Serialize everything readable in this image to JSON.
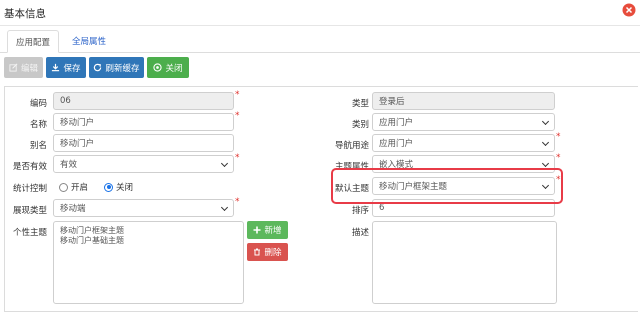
{
  "dialog": {
    "title": "基本信息"
  },
  "tabs": [
    {
      "label": "应用配置"
    },
    {
      "label": "全局属性"
    }
  ],
  "toolbar": {
    "edit_label": "编辑",
    "save_label": "保存",
    "refresh_label": "刷新缓存",
    "close_label": "关闭"
  },
  "form": {
    "code": {
      "label": "编码",
      "value": "06"
    },
    "name": {
      "label": "名称",
      "value": "移动门户"
    },
    "alias": {
      "label": "别名",
      "value": "移动门户"
    },
    "valid": {
      "label": "是否有效",
      "value": "有效"
    },
    "stats": {
      "label": "统计控制",
      "options": [
        "开启",
        "关闭"
      ],
      "selected": "关闭"
    },
    "display_type": {
      "label": "展现类型",
      "value": "移动端"
    },
    "personal_theme": {
      "label": "个性主题",
      "items": [
        "移动门户框架主题",
        "移动门户基础主题"
      ]
    },
    "type": {
      "label": "类型",
      "value": "登录后"
    },
    "category": {
      "label": "类别",
      "value": "应用门户"
    },
    "nav_use": {
      "label": "导航用途",
      "value": "应用门户"
    },
    "theme_attr": {
      "label": "主题属性",
      "value": "嵌入模式"
    },
    "default_theme": {
      "label": "默认主题",
      "value": "移动门户框架主题"
    },
    "order": {
      "label": "排序",
      "value": "6"
    },
    "description": {
      "label": "描述",
      "value": ""
    },
    "add_label": "新增",
    "delete_label": "删除"
  },
  "colors": {
    "primary": "#2f76b8",
    "success": "#4cae4c",
    "danger": "#d9534f",
    "highlight": "#e83b47",
    "required": "#e0322e"
  }
}
